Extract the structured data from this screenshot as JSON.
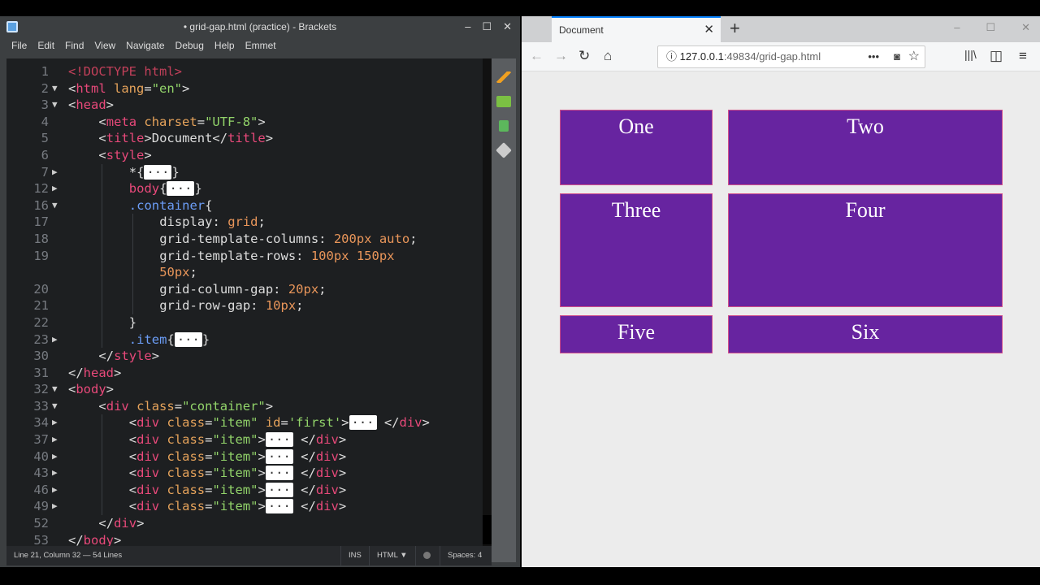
{
  "editor": {
    "title": "• grid-gap.html (practice) - Brackets",
    "menu": [
      "File",
      "Edit",
      "Find",
      "View",
      "Navigate",
      "Debug",
      "Help",
      "Emmet"
    ],
    "lines": [
      {
        "n": "1",
        "fold": "",
        "indent": 0,
        "tokens": [
          [
            "<!DOCTYPE html>",
            "doc"
          ]
        ]
      },
      {
        "n": "2",
        "fold": "▼",
        "indent": 0,
        "tokens": [
          [
            "<",
            "br"
          ],
          [
            "html",
            "tag"
          ],
          [
            " lang",
            "attr"
          ],
          [
            "=",
            "pl"
          ],
          [
            "\"en\"",
            "str"
          ],
          [
            ">",
            "br"
          ]
        ]
      },
      {
        "n": "3",
        "fold": "▼",
        "indent": 0,
        "tokens": [
          [
            "<",
            "br"
          ],
          [
            "head",
            "tag"
          ],
          [
            ">",
            "br"
          ]
        ]
      },
      {
        "n": "4",
        "fold": "",
        "indent": 1,
        "tokens": [
          [
            "<",
            "br"
          ],
          [
            "meta",
            "tag"
          ],
          [
            " charset",
            "attr"
          ],
          [
            "=",
            "pl"
          ],
          [
            "\"UTF-8\"",
            "str"
          ],
          [
            ">",
            "br"
          ]
        ]
      },
      {
        "n": "5",
        "fold": "",
        "indent": 1,
        "tokens": [
          [
            "<",
            "br"
          ],
          [
            "title",
            "tag"
          ],
          [
            ">",
            "br"
          ],
          [
            "Document",
            "pl"
          ],
          [
            "</",
            "br"
          ],
          [
            "title",
            "tag"
          ],
          [
            ">",
            "br"
          ]
        ]
      },
      {
        "n": "6",
        "fold": "",
        "indent": 1,
        "tokens": [
          [
            "<",
            "br"
          ],
          [
            "style",
            "tag"
          ],
          [
            ">",
            "br"
          ]
        ]
      },
      {
        "n": "7",
        "fold": "▶",
        "indent": 2,
        "tokens": [
          [
            "*{",
            "pl"
          ],
          [
            "···",
            "fold"
          ],
          [
            "}",
            "pl"
          ]
        ]
      },
      {
        "n": "12",
        "fold": "▶",
        "indent": 2,
        "tokens": [
          [
            "body",
            "tag"
          ],
          [
            "{",
            "pl"
          ],
          [
            "···",
            "fold"
          ],
          [
            "}",
            "pl"
          ]
        ]
      },
      {
        "n": "16",
        "fold": "▼",
        "indent": 2,
        "tokens": [
          [
            ".container",
            "sel"
          ],
          [
            "{",
            "pl"
          ]
        ]
      },
      {
        "n": "17",
        "fold": "",
        "indent": 3,
        "tokens": [
          [
            "display: ",
            "prop"
          ],
          [
            "grid",
            "val"
          ],
          [
            ";",
            "pl"
          ]
        ]
      },
      {
        "n": "18",
        "fold": "",
        "indent": 3,
        "tokens": [
          [
            "grid-template-columns: ",
            "prop"
          ],
          [
            "200px auto",
            "val"
          ],
          [
            ";",
            "pl"
          ]
        ]
      },
      {
        "n": "19",
        "fold": "",
        "indent": 3,
        "tokens": [
          [
            "grid-template-rows: ",
            "prop"
          ],
          [
            "100px 150px",
            "val"
          ]
        ]
      },
      {
        "n": "",
        "fold": "",
        "indent": 3,
        "tokens": [
          [
            "50px",
            "val"
          ],
          [
            ";",
            "pl"
          ]
        ]
      },
      {
        "n": "20",
        "fold": "",
        "indent": 3,
        "tokens": [
          [
            "grid-column-gap: ",
            "prop"
          ],
          [
            "20px",
            "val"
          ],
          [
            ";",
            "pl"
          ]
        ]
      },
      {
        "n": "21",
        "fold": "",
        "indent": 3,
        "tokens": [
          [
            "grid-row-gap: ",
            "prop"
          ],
          [
            "10px",
            "val"
          ],
          [
            ";",
            "pl"
          ]
        ]
      },
      {
        "n": "22",
        "fold": "",
        "indent": 2,
        "tokens": [
          [
            "}",
            "pl"
          ]
        ]
      },
      {
        "n": "23",
        "fold": "▶",
        "indent": 2,
        "tokens": [
          [
            ".item",
            "sel"
          ],
          [
            "{",
            "pl"
          ],
          [
            "···",
            "fold"
          ],
          [
            "}",
            "pl"
          ]
        ]
      },
      {
        "n": "30",
        "fold": "",
        "indent": 1,
        "tokens": [
          [
            "</",
            "br"
          ],
          [
            "style",
            "tag"
          ],
          [
            ">",
            "br"
          ]
        ]
      },
      {
        "n": "31",
        "fold": "",
        "indent": 0,
        "tokens": [
          [
            "</",
            "br"
          ],
          [
            "head",
            "tag"
          ],
          [
            ">",
            "br"
          ]
        ]
      },
      {
        "n": "32",
        "fold": "▼",
        "indent": 0,
        "tokens": [
          [
            "<",
            "br"
          ],
          [
            "body",
            "tag"
          ],
          [
            ">",
            "br"
          ]
        ]
      },
      {
        "n": "33",
        "fold": "▼",
        "indent": 1,
        "tokens": [
          [
            "<",
            "br"
          ],
          [
            "div",
            "tag"
          ],
          [
            " class",
            "attr"
          ],
          [
            "=",
            "pl"
          ],
          [
            "\"container\"",
            "str"
          ],
          [
            ">",
            "br"
          ]
        ]
      },
      {
        "n": "34",
        "fold": "▶",
        "indent": 2,
        "tokens": [
          [
            "<",
            "br"
          ],
          [
            "div",
            "tag"
          ],
          [
            " class",
            "attr"
          ],
          [
            "=",
            "pl"
          ],
          [
            "\"item\"",
            "str"
          ],
          [
            " id",
            "attr"
          ],
          [
            "=",
            "pl"
          ],
          [
            "'first'",
            "str"
          ],
          [
            ">",
            "br"
          ],
          [
            "···",
            "fold"
          ],
          [
            " </",
            "br"
          ],
          [
            "div",
            "tag"
          ],
          [
            ">",
            "br"
          ]
        ]
      },
      {
        "n": "37",
        "fold": "▶",
        "indent": 2,
        "tokens": [
          [
            "<",
            "br"
          ],
          [
            "div",
            "tag"
          ],
          [
            " class",
            "attr"
          ],
          [
            "=",
            "pl"
          ],
          [
            "\"item\"",
            "str"
          ],
          [
            ">",
            "br"
          ],
          [
            "···",
            "fold"
          ],
          [
            " </",
            "br"
          ],
          [
            "div",
            "tag"
          ],
          [
            ">",
            "br"
          ]
        ]
      },
      {
        "n": "40",
        "fold": "▶",
        "indent": 2,
        "tokens": [
          [
            "<",
            "br"
          ],
          [
            "div",
            "tag"
          ],
          [
            " class",
            "attr"
          ],
          [
            "=",
            "pl"
          ],
          [
            "\"item\"",
            "str"
          ],
          [
            ">",
            "br"
          ],
          [
            "···",
            "fold"
          ],
          [
            " </",
            "br"
          ],
          [
            "div",
            "tag"
          ],
          [
            ">",
            "br"
          ]
        ]
      },
      {
        "n": "43",
        "fold": "▶",
        "indent": 2,
        "tokens": [
          [
            "<",
            "br"
          ],
          [
            "div",
            "tag"
          ],
          [
            " class",
            "attr"
          ],
          [
            "=",
            "pl"
          ],
          [
            "\"item\"",
            "str"
          ],
          [
            ">",
            "br"
          ],
          [
            "···",
            "fold"
          ],
          [
            " </",
            "br"
          ],
          [
            "div",
            "tag"
          ],
          [
            ">",
            "br"
          ]
        ]
      },
      {
        "n": "46",
        "fold": "▶",
        "indent": 2,
        "tokens": [
          [
            "<",
            "br"
          ],
          [
            "div",
            "tag"
          ],
          [
            " class",
            "attr"
          ],
          [
            "=",
            "pl"
          ],
          [
            "\"item\"",
            "str"
          ],
          [
            ">",
            "br"
          ],
          [
            "···",
            "fold"
          ],
          [
            " </",
            "br"
          ],
          [
            "div",
            "tag"
          ],
          [
            ">",
            "br"
          ]
        ]
      },
      {
        "n": "49",
        "fold": "▶",
        "indent": 2,
        "tokens": [
          [
            "<",
            "br"
          ],
          [
            "div",
            "tag"
          ],
          [
            " class",
            "attr"
          ],
          [
            "=",
            "pl"
          ],
          [
            "\"item\"",
            "str"
          ],
          [
            ">",
            "br"
          ],
          [
            "···",
            "fold"
          ],
          [
            " </",
            "br"
          ],
          [
            "div",
            "tag"
          ],
          [
            ">",
            "br"
          ]
        ]
      },
      {
        "n": "52",
        "fold": "",
        "indent": 1,
        "tokens": [
          [
            "</",
            "br"
          ],
          [
            "div",
            "tag"
          ],
          [
            ">",
            "br"
          ]
        ]
      },
      {
        "n": "53",
        "fold": "",
        "indent": 0,
        "tokens": [
          [
            "</",
            "br"
          ],
          [
            "body",
            "tag"
          ],
          [
            ">",
            "br"
          ]
        ]
      }
    ],
    "status": {
      "position": "Line 21, Column 32 — 54 Lines",
      "mode": "INS",
      "language": "HTML ▼",
      "spaces": "Spaces: 4"
    }
  },
  "browser": {
    "tab_title": "Document",
    "url_host": "127.0.0.1",
    "url_path": ":49834/grid-gap.html",
    "items": [
      "One",
      "Two",
      "Three",
      "Four",
      "Five",
      "Six"
    ],
    "item_color": "#6724a0"
  }
}
